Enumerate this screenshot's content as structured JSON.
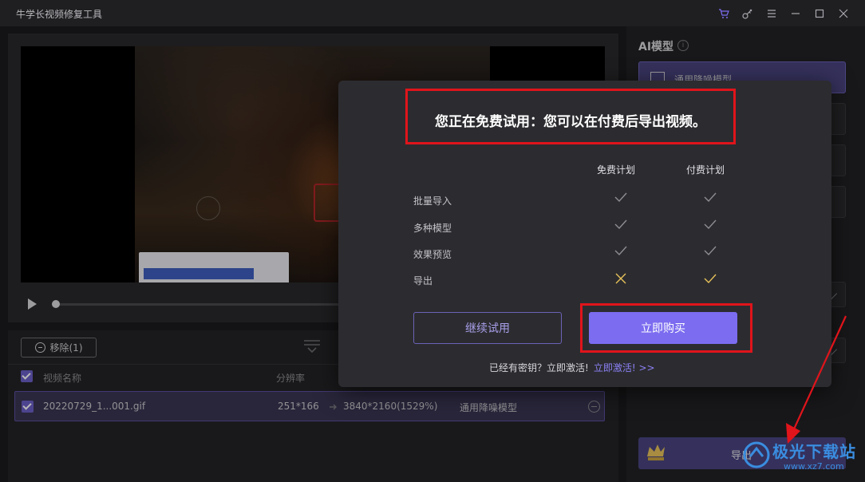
{
  "window": {
    "title": "牛学长视频修复工具",
    "icons": [
      "cart-icon",
      "key-icon",
      "menu-icon",
      "minimize-icon",
      "maximize-icon",
      "close-icon"
    ]
  },
  "player": {
    "progress": 0
  },
  "list": {
    "remove_label": "移除(1)",
    "headers": {
      "name": "视频名称",
      "resolution": "分辨率"
    },
    "rows": [
      {
        "name": "20220729_1...001.gif",
        "from_res": "251*166",
        "to_res": "3840*2160(1529%)",
        "model": "通用降噪模型"
      }
    ]
  },
  "right_panel": {
    "ai_title": "AI模型",
    "selected_model": "通用降噪模型",
    "export_label": "导出"
  },
  "modal": {
    "title": "您正在免费试用：您可以在付费后导出视频。",
    "plans": [
      "免费计划",
      "付费计划"
    ],
    "features": [
      {
        "name": "批量导入",
        "free": "check",
        "paid": "check"
      },
      {
        "name": "多种模型",
        "free": "check",
        "paid": "check"
      },
      {
        "name": "效果预览",
        "free": "check",
        "paid": "check"
      },
      {
        "name": "导出",
        "free": "cross",
        "paid": "check"
      }
    ],
    "continue_label": "继续试用",
    "buy_label": "立即购买",
    "activate_text": "已经有密钥？立即激活!",
    "activate_link": "立即激活! >>"
  },
  "watermark": {
    "text": "极光下载站",
    "url": "www.xz7.com"
  },
  "colors": {
    "accent": "#7b6cf0",
    "annotation_red": "#e0141b",
    "check_gray": "#8e8e93",
    "gold": "#e8c25a"
  }
}
